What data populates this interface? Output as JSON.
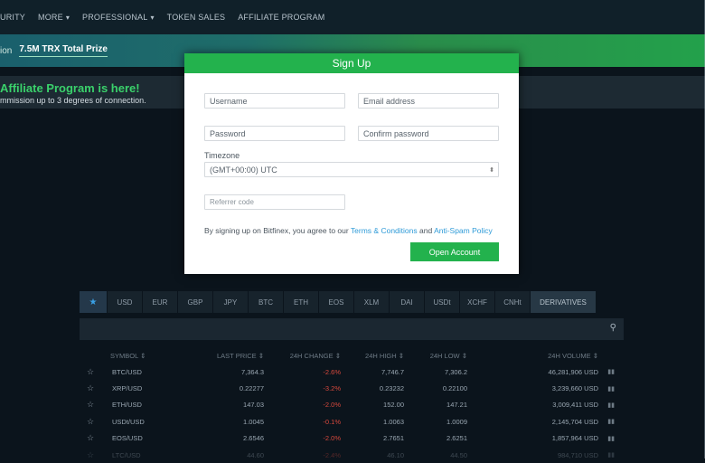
{
  "nav": {
    "items": [
      {
        "label": "URITY",
        "chev": ""
      },
      {
        "label": "MORE",
        "chev": "▾"
      },
      {
        "label": "PROFESSIONAL",
        "chev": "▾"
      },
      {
        "label": "TOKEN SALES",
        "chev": ""
      },
      {
        "label": "AFFILIATE PROGRAM",
        "chev": ""
      }
    ]
  },
  "banner": {
    "left": "ion",
    "prize": "7.5M TRX Total Prize"
  },
  "affiliate": {
    "title": "Affiliate Program is here!",
    "subtitle": "mmission up to 3 degrees of connection."
  },
  "signup": {
    "title": "Sign Up",
    "username_placeholder": "Username",
    "email_placeholder": "Email address",
    "password_placeholder": "Password",
    "confirm_placeholder": "Confirm password",
    "timezone_label": "Timezone",
    "timezone_value": "(GMT+00:00) UTC",
    "referrer_placeholder": "Referrer code",
    "terms_prefix": "By signing up on Bitfinex, you agree to our ",
    "terms_link": "Terms & Conditions",
    "terms_and": " and ",
    "antispam_link": "Anti-Spam Policy",
    "button": "Open Account"
  },
  "tabs": [
    {
      "label": "★",
      "name": "favorites-tab",
      "w": 30
    },
    {
      "label": "USD",
      "name": "tab-usd",
      "w": 38
    },
    {
      "label": "EUR",
      "name": "tab-eur",
      "w": 38
    },
    {
      "label": "GBP",
      "name": "tab-gbp",
      "w": 38
    },
    {
      "label": "JPY",
      "name": "tab-jpy",
      "w": 38
    },
    {
      "label": "BTC",
      "name": "tab-btc",
      "w": 38
    },
    {
      "label": "ETH",
      "name": "tab-eth",
      "w": 38
    },
    {
      "label": "EOS",
      "name": "tab-eos",
      "w": 38
    },
    {
      "label": "XLM",
      "name": "tab-xlm",
      "w": 38
    },
    {
      "label": "DAI",
      "name": "tab-dai",
      "w": 38
    },
    {
      "label": "USDt",
      "name": "tab-usdt",
      "w": 38
    },
    {
      "label": "XCHF",
      "name": "tab-xchf",
      "w": 38
    },
    {
      "label": "CNHt",
      "name": "tab-cnht",
      "w": 38
    },
    {
      "label": "DERIVATIVES",
      "name": "tab-derivatives",
      "w": 72
    }
  ],
  "table": {
    "headers": [
      "SYMBOL ⇕",
      "LAST PRICE ⇕",
      "24H CHANGE ⇕",
      "24H HIGH ⇕",
      "24H LOW ⇕",
      "24H VOLUME ⇕"
    ],
    "rows": [
      {
        "symbol": "BTC/USD",
        "last": "7,364.3",
        "change": "-2.6%",
        "high": "7,746.7",
        "low": "7,306.2",
        "volume": "46,281,906 USD"
      },
      {
        "symbol": "XRP/USD",
        "last": "0.22277",
        "change": "-3.2%",
        "high": "0.23232",
        "low": "0.22100",
        "volume": "3,239,660 USD"
      },
      {
        "symbol": "ETH/USD",
        "last": "147.03",
        "change": "-2.0%",
        "high": "152.00",
        "low": "147.21",
        "volume": "3,009,411 USD"
      },
      {
        "symbol": "USDt/USD",
        "last": "1.0045",
        "change": "-0.1%",
        "high": "1.0063",
        "low": "1.0009",
        "volume": "2,145,704 USD"
      },
      {
        "symbol": "EOS/USD",
        "last": "2.6546",
        "change": "-2.0%",
        "high": "2.7651",
        "low": "2.6251",
        "volume": "1,857,964 USD"
      },
      {
        "symbol": "LTC/USD",
        "last": "44.60",
        "change": "-2.4%",
        "high": "46.10",
        "low": "44.50",
        "volume": "984,710 USD"
      }
    ]
  },
  "colors": {
    "accent": "#23b24d",
    "link": "#2f9bd8",
    "negative": "#d8493d",
    "background": "#0b141c"
  }
}
